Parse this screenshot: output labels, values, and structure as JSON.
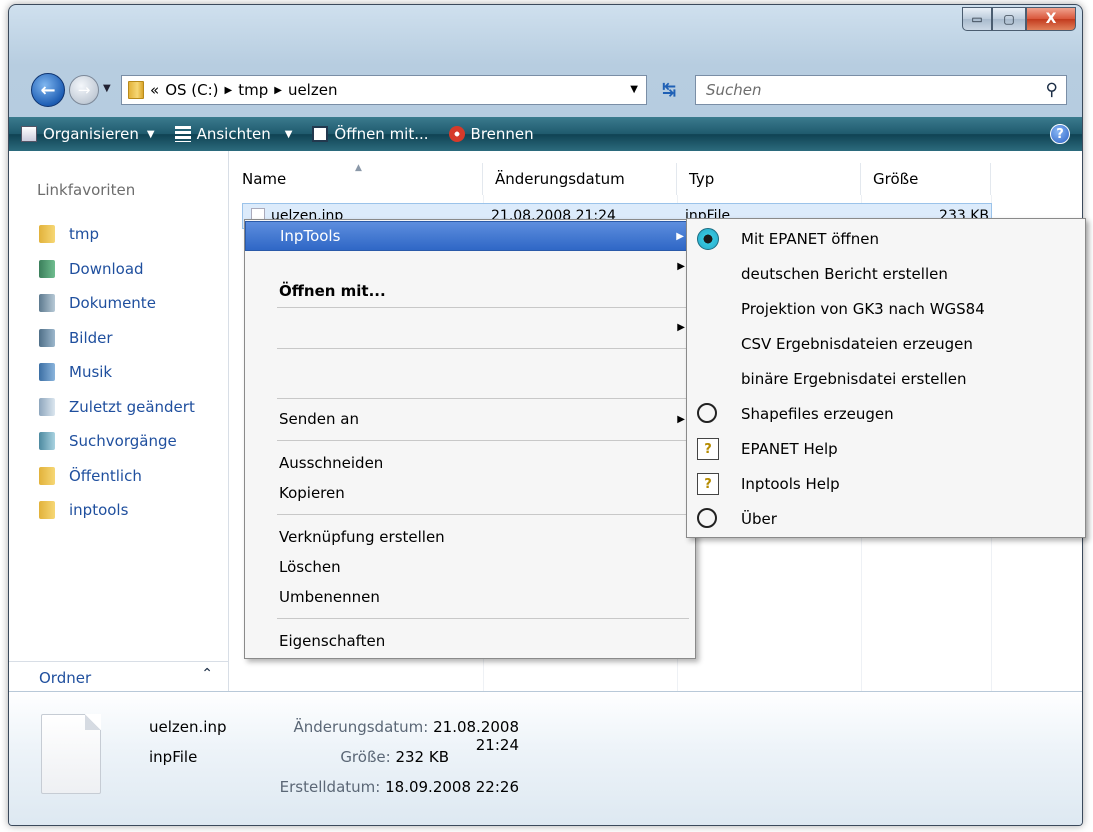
{
  "window": {
    "min_label": "▭",
    "max_label": "▢",
    "close_label": "X"
  },
  "address": {
    "prefix": "«",
    "crumbs": [
      "OS (C:)",
      "tmp",
      "uelzen"
    ],
    "search_placeholder": "Suchen"
  },
  "toolbar": {
    "organize": "Organisieren",
    "views": "Ansichten",
    "open_with": "Öffnen mit...",
    "burn": "Brennen",
    "help": "?"
  },
  "nav": {
    "title": "Linkfavoriten",
    "items": [
      {
        "label": "tmp",
        "icon": "folder-icon"
      },
      {
        "label": "Download",
        "icon": "download-icon"
      },
      {
        "label": "Dokumente",
        "icon": "documents-icon"
      },
      {
        "label": "Bilder",
        "icon": "pictures-icon"
      },
      {
        "label": "Musik",
        "icon": "music-icon"
      },
      {
        "label": "Zuletzt geändert",
        "icon": "recent-icon"
      },
      {
        "label": "Suchvorgänge",
        "icon": "searches-icon"
      },
      {
        "label": "Öffentlich",
        "icon": "folder-icon"
      },
      {
        "label": "inptools",
        "icon": "folder-icon"
      }
    ],
    "folders": "Ordner"
  },
  "columns": {
    "name": "Name",
    "date": "Änderungsdatum",
    "type": "Typ",
    "size": "Größe"
  },
  "file": {
    "name": "uelzen.inp",
    "date": "21.08.2008 21:24",
    "type": "inpFile",
    "size": "233 KB"
  },
  "context_menu": {
    "inptools": "InpTools",
    "open_with": "Öffnen mit...",
    "send_to": "Senden an",
    "cut": "Ausschneiden",
    "copy": "Kopieren",
    "shortcut": "Verknüpfung erstellen",
    "delete": "Löschen",
    "rename": "Umbenennen",
    "properties": "Eigenschaften"
  },
  "submenu": [
    {
      "label": "Mit EPANET öffnen",
      "icon": "epanet-icon"
    },
    {
      "label": "deutschen Bericht erstellen",
      "icon": ""
    },
    {
      "label": "Projektion von GK3 nach WGS84",
      "icon": ""
    },
    {
      "label": "CSV Ergebnisdateien erzeugen",
      "icon": ""
    },
    {
      "label": "binäre Ergebnisdatei erstellen",
      "icon": ""
    },
    {
      "label": "Shapefiles erzeugen",
      "icon": "circle-icon"
    },
    {
      "label": "EPANET Help",
      "icon": "help-file-icon"
    },
    {
      "label": "Inptools Help",
      "icon": "help-file-icon"
    },
    {
      "label": "Über",
      "icon": "circle-icon"
    }
  ],
  "details": {
    "name": "uelzen.inp",
    "type": "inpFile",
    "mod_label": "Änderungsdatum:",
    "mod_value": "21.08.2008 21:24",
    "size_label": "Größe:",
    "size_value": "232 KB",
    "created_label": "Erstelldatum:",
    "created_value": "18.09.2008 22:26"
  }
}
